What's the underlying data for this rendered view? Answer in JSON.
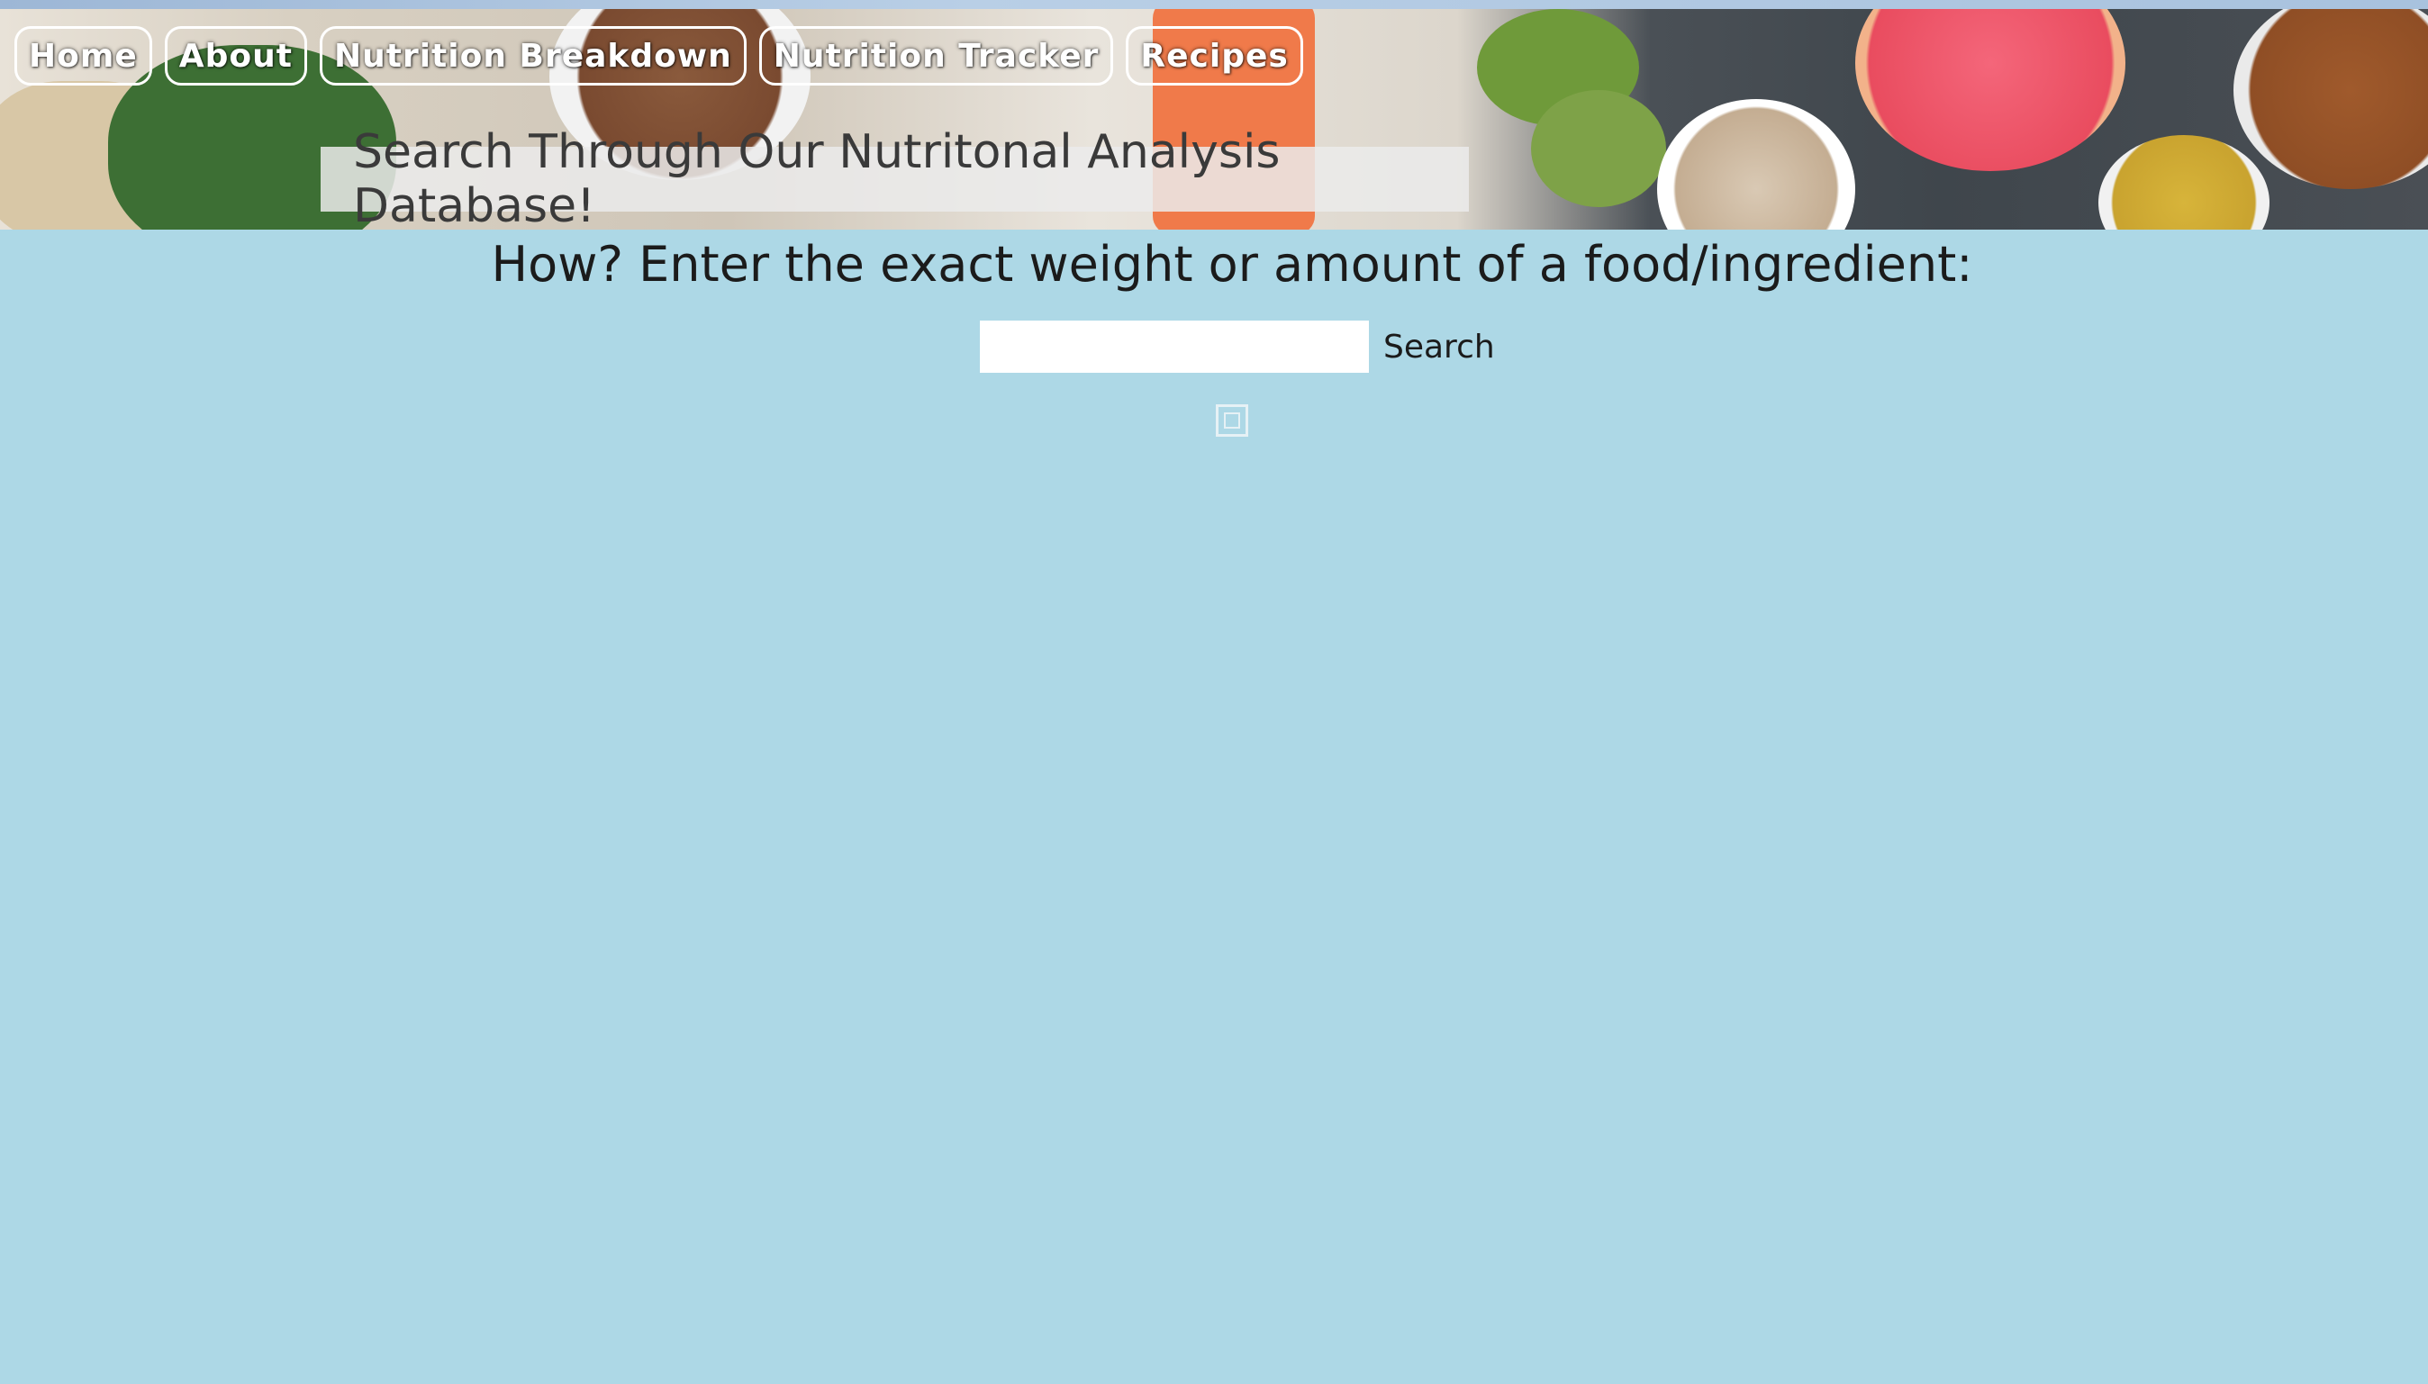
{
  "nav": {
    "items": [
      {
        "label": "Home"
      },
      {
        "label": "About"
      },
      {
        "label": "Nutrition Breakdown"
      },
      {
        "label": "Nutrition Tracker"
      },
      {
        "label": "Recipes"
      }
    ]
  },
  "banner": {
    "title": "Search Through Our Nutritonal Analysis Database!"
  },
  "main": {
    "instructions": "How? Enter the exact weight or amount of a food/ingredient:",
    "search": {
      "value": "",
      "placeholder": "",
      "button_label": "Search"
    },
    "result_image_icon": "image-placeholder-icon"
  },
  "colors": {
    "page_background": "#add8e6",
    "nav_text": "#ffffff"
  }
}
